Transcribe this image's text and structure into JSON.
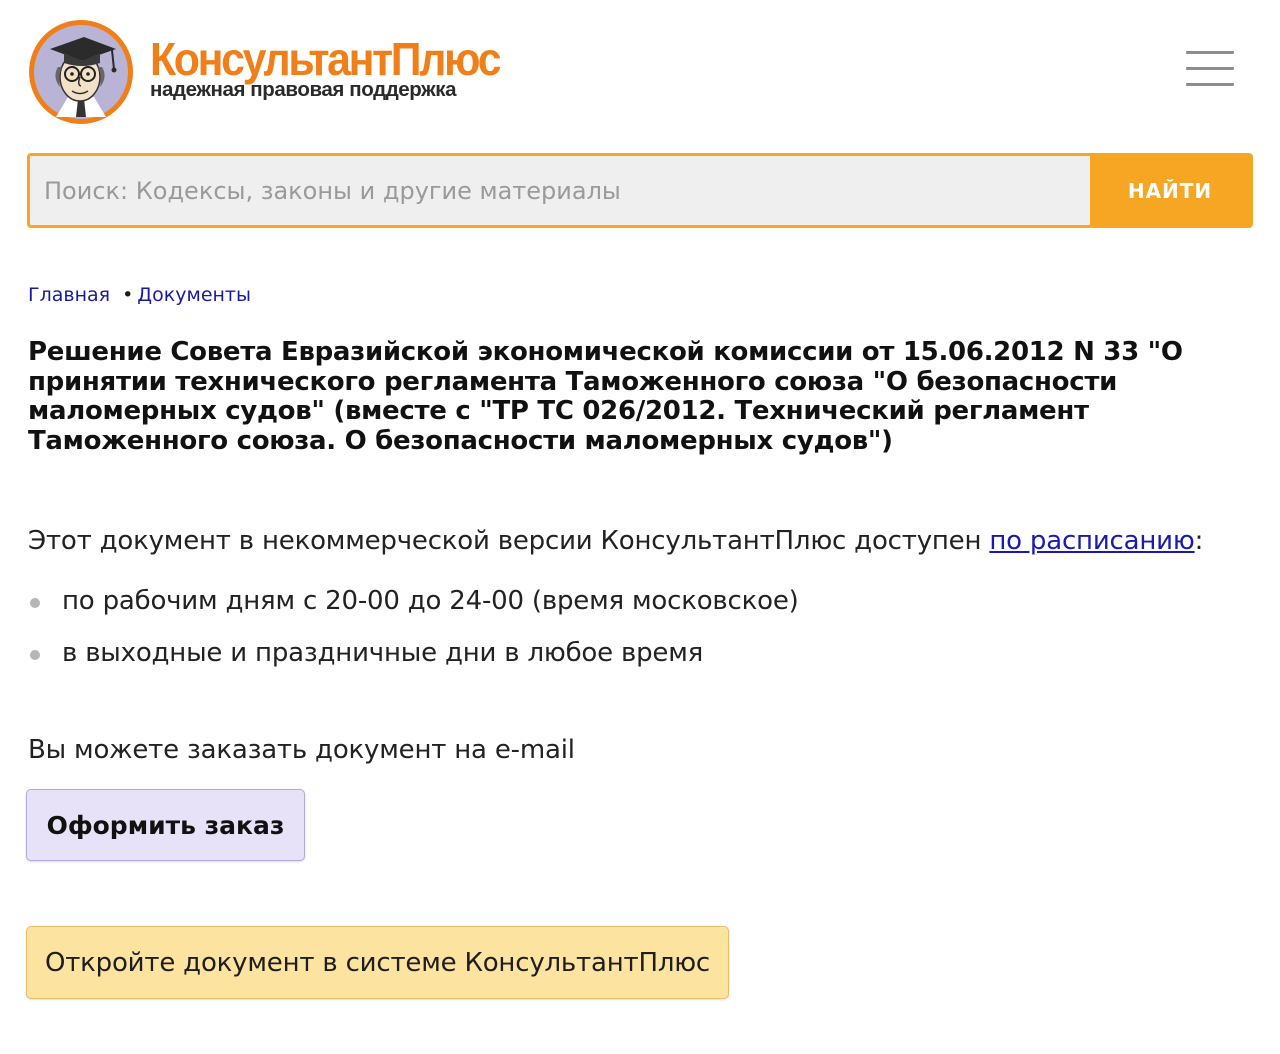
{
  "header": {
    "logo_brand": "КонсультантПлюс",
    "logo_tagline": "надежная правовая поддержка",
    "menu_icon": "hamburger-menu-icon"
  },
  "search": {
    "placeholder": "Поиск: Кодексы, законы и другие материалы",
    "button_label": "НАЙТИ"
  },
  "breadcrumb": {
    "home": "Главная",
    "separator": "•",
    "current": "Документы"
  },
  "document": {
    "title": "Решение Совета Евразийской экономической комиссии от 15.06.2012 N 33 \"О принятии технического регламента Таможенного союза \"О безопасности маломерных судов\" (вместе с \"ТР ТС 026/2012. Технический регламент Таможенного союза. О безопасности маломерных судов\")"
  },
  "availability": {
    "text": "Этот документ в некоммерческой версии КонсультантПлюс доступен ",
    "link": "по расписанию",
    "suffix": ":",
    "items": [
      "по рабочим дням с 20-00 до 24-00 (время московское)",
      "в выходные и праздничные дни в любое время"
    ]
  },
  "order": {
    "text": "Вы можете заказать документ на e-mail",
    "button_label": "Оформить заказ"
  },
  "open": {
    "button_label": "Откройте документ в системе КонсультантПлюс"
  },
  "colors": {
    "accent_orange": "#f6a623",
    "brand_orange": "#f07f1a",
    "link_blue": "#1a1ab0",
    "order_button_bg": "#e8e2f8",
    "open_button_bg": "#fde3a0"
  }
}
